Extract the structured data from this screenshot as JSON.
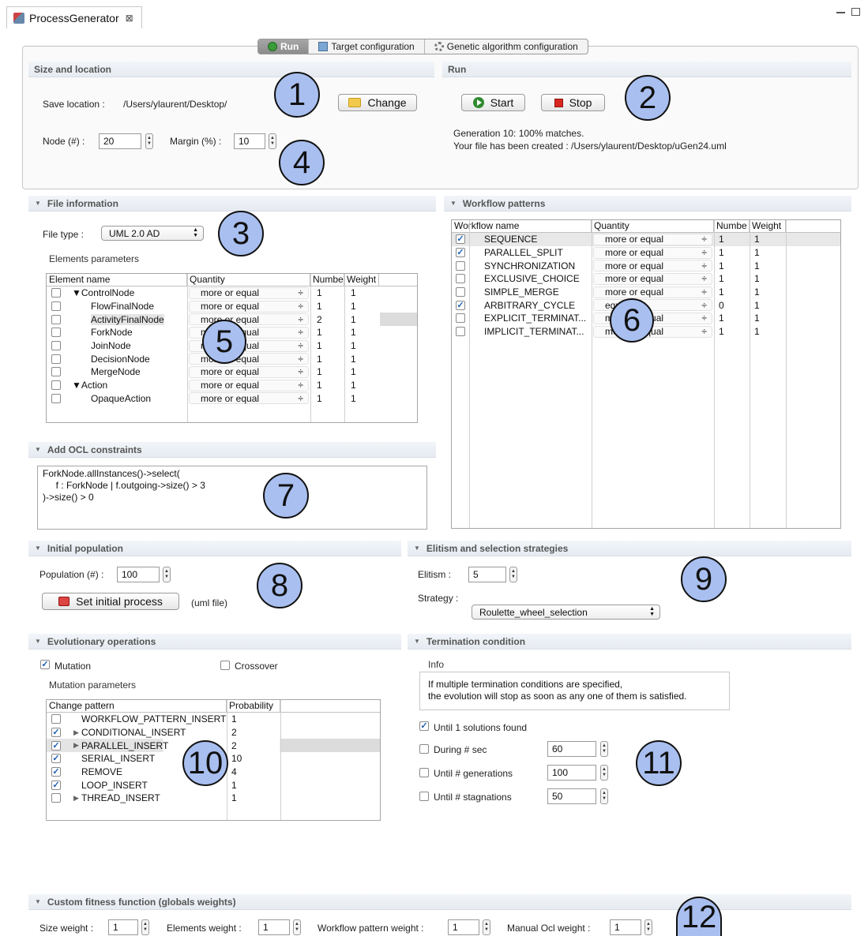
{
  "editor": {
    "tab_title": "ProcessGenerator",
    "close_glyph": "⊠"
  },
  "tabs": [
    {
      "label": "Run",
      "icon": "run-icon"
    },
    {
      "label": "Target configuration",
      "icon": "target-icon"
    },
    {
      "label": "Genetic algorithm configuration",
      "icon": "cog-icon"
    }
  ],
  "size_location": {
    "title": "Size and location",
    "save_location_label": "Save location :",
    "save_location_value": "/Users/ylaurent/Desktop/",
    "change_label": "Change",
    "node_label": "Node (#) :",
    "node_value": "20",
    "margin_label": "Margin (%) :",
    "margin_value": "10"
  },
  "run": {
    "title": "Run",
    "start_label": "Start",
    "stop_label": "Stop",
    "status_line1": "Generation 10: 100% matches.",
    "status_line2": "Your file has been created : /Users/ylaurent/Desktop/uGen24.uml"
  },
  "file_info": {
    "title": "File information",
    "file_type_label": "File type :",
    "file_type_value": "UML 2.0 AD",
    "elements_params_label": "Elements parameters",
    "columns": [
      "Element name",
      "Quantity",
      "Numbe",
      "Weight"
    ],
    "rows": [
      {
        "name": "▼ControlNode",
        "indent": 0,
        "quantity": "more or equal",
        "number": "1",
        "weight": "1"
      },
      {
        "name": "FlowFinalNode",
        "indent": 1,
        "quantity": "more or equal",
        "number": "1",
        "weight": "1"
      },
      {
        "name": "ActivityFinalNode",
        "indent": 1,
        "quantity": "more or equal",
        "number": "2",
        "weight": "1"
      },
      {
        "name": "ForkNode",
        "indent": 1,
        "quantity": "more or equal",
        "number": "1",
        "weight": "1"
      },
      {
        "name": "JoinNode",
        "indent": 1,
        "quantity": "more or equal",
        "number": "1",
        "weight": "1"
      },
      {
        "name": "DecisionNode",
        "indent": 1,
        "quantity": "more or equal",
        "number": "1",
        "weight": "1"
      },
      {
        "name": "MergeNode",
        "indent": 1,
        "quantity": "more or equal",
        "number": "1",
        "weight": "1"
      },
      {
        "name": "▼Action",
        "indent": 0,
        "quantity": "more or equal",
        "number": "1",
        "weight": "1"
      },
      {
        "name": "OpaqueAction",
        "indent": 1,
        "quantity": "more or equal",
        "number": "1",
        "weight": "1"
      }
    ]
  },
  "workflow": {
    "title": "Workflow patterns",
    "columns": [
      "Workflow name",
      "Quantity",
      "Numbe",
      "Weight"
    ],
    "rows": [
      {
        "name": "SEQUENCE",
        "checked": true,
        "quantity": "more or equal",
        "number": "1",
        "weight": "1"
      },
      {
        "name": "PARALLEL_SPLIT",
        "checked": true,
        "quantity": "more or equal",
        "number": "1",
        "weight": "1"
      },
      {
        "name": "SYNCHRONIZATION",
        "checked": false,
        "quantity": "more or equal",
        "number": "1",
        "weight": "1"
      },
      {
        "name": "EXCLUSIVE_CHOICE",
        "checked": false,
        "quantity": "more or equal",
        "number": "1",
        "weight": "1"
      },
      {
        "name": "SIMPLE_MERGE",
        "checked": false,
        "quantity": "more or equal",
        "number": "1",
        "weight": "1"
      },
      {
        "name": "ARBITRARY_CYCLE",
        "checked": true,
        "quantity": "equal",
        "number": "0",
        "weight": "1"
      },
      {
        "name": "EXPLICIT_TERMINAT...",
        "checked": false,
        "quantity": "more or equal",
        "number": "1",
        "weight": "1"
      },
      {
        "name": "IMPLICIT_TERMINAT...",
        "checked": false,
        "quantity": "more or equal",
        "number": "1",
        "weight": "1"
      }
    ]
  },
  "ocl": {
    "title": "Add OCL constraints",
    "text": "ForkNode.allInstances()->select(\n     f : ForkNode | f.outgoing->size() > 3\n)->size() > 0"
  },
  "initial_population": {
    "title": "Initial population",
    "population_label": "Population (#) :",
    "population_value": "100",
    "set_initial_label": "Set initial process",
    "uml_file_label": "(uml file)"
  },
  "elitism": {
    "title": "Elitism and selection strategies",
    "elitism_label": "Elitism :",
    "elitism_value": "5",
    "strategy_label": "Strategy :",
    "strategy_value": "Roulette_wheel_selection"
  },
  "evolution": {
    "title": "Evolutionary operations",
    "mutation_label": "Mutation",
    "mutation_checked": true,
    "crossover_label": "Crossover",
    "crossover_checked": false,
    "mutation_params_label": "Mutation parameters",
    "columns": [
      "Change pattern",
      "Probability"
    ],
    "rows": [
      {
        "name": "WORKFLOW_PATTERN_INSERT",
        "prefix": "",
        "checked": false,
        "prob": "1"
      },
      {
        "name": "CONDITIONAL_INSERT",
        "prefix": "▶",
        "checked": true,
        "prob": "2"
      },
      {
        "name": "PARALLEL_INSERT",
        "prefix": "▶",
        "checked": true,
        "prob": "2"
      },
      {
        "name": "SERIAL_INSERT",
        "prefix": "",
        "checked": true,
        "prob": "10"
      },
      {
        "name": "REMOVE",
        "prefix": "",
        "checked": true,
        "prob": "4"
      },
      {
        "name": "LOOP_INSERT",
        "prefix": "",
        "checked": true,
        "prob": "1"
      },
      {
        "name": "THREAD_INSERT",
        "prefix": "▶",
        "checked": false,
        "prob": "1"
      }
    ]
  },
  "termination": {
    "title": "Termination condition",
    "info_label": "Info",
    "info_line1": "If multiple termination conditions are specified,",
    "info_line2": "the evolution will stop as soon as any one of them is satisfied.",
    "until_solutions_label": "Until 1 solutions found",
    "until_solutions_checked": true,
    "during_sec_label": "During # sec",
    "during_sec_value": "60",
    "until_gen_label": "Until # generations",
    "until_gen_value": "100",
    "until_stag_label": "Until # stagnations",
    "until_stag_value": "50"
  },
  "fitness": {
    "title": "Custom fitness function (globals weights)",
    "size_label": "Size weight :",
    "size_value": "1",
    "elements_label": "Elements weight :",
    "elements_value": "1",
    "workflow_label": "Workflow pattern weight :",
    "workflow_value": "1",
    "ocl_label": "Manual Ocl weight :",
    "ocl_value": "1"
  },
  "markers": [
    "1",
    "2",
    "3",
    "4",
    "5",
    "6",
    "7",
    "8",
    "9",
    "10",
    "11",
    "12"
  ]
}
